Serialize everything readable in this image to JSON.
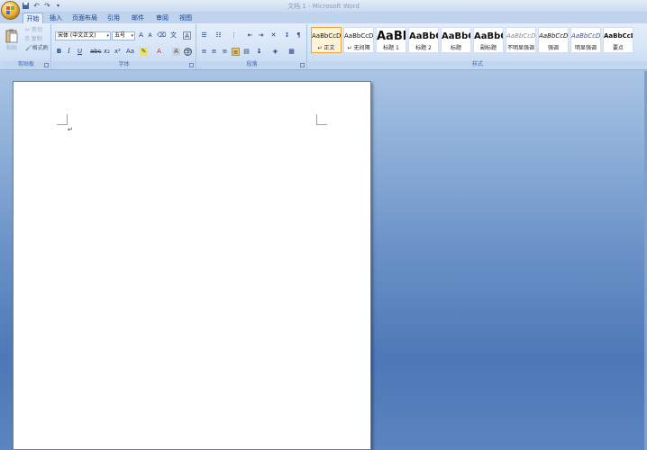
{
  "window": {
    "title": "文档 1 - Microsoft Word"
  },
  "qat": {
    "save": "save-icon",
    "undo": "undo-icon",
    "redo": "redo-icon",
    "customize": "▾"
  },
  "tabs": [
    "开始",
    "插入",
    "页面布局",
    "引用",
    "邮件",
    "审阅",
    "视图"
  ],
  "clipboard": {
    "paste": "粘贴",
    "cut": "剪切",
    "copy": "复制",
    "format_painter": "格式刷",
    "label": "剪贴板"
  },
  "font": {
    "name": "宋体 (中文正文)",
    "size": "五号",
    "label": "字体"
  },
  "paragraph": {
    "label": "段落"
  },
  "styles": {
    "label": "样式",
    "items": [
      {
        "sample": "AaBbCcDd",
        "name": "↵ 正文"
      },
      {
        "sample": "AaBbCcDd",
        "name": "↵ 无间隔"
      },
      {
        "sample": "AaBb",
        "name": "标题 1"
      },
      {
        "sample": "AaBbC",
        "name": "标题 2"
      },
      {
        "sample": "AaBbC",
        "name": "标题"
      },
      {
        "sample": "AaBbC",
        "name": "副标题"
      },
      {
        "sample": "AaBbCcDd",
        "name": "不明显强调"
      },
      {
        "sample": "AaBbCcDd",
        "name": "强调"
      },
      {
        "sample": "AaBbCcDd",
        "name": "明显强调"
      },
      {
        "sample": "AaBbCcDd",
        "name": "要点"
      }
    ]
  },
  "document": {
    "paragraph_mark": "↵"
  }
}
